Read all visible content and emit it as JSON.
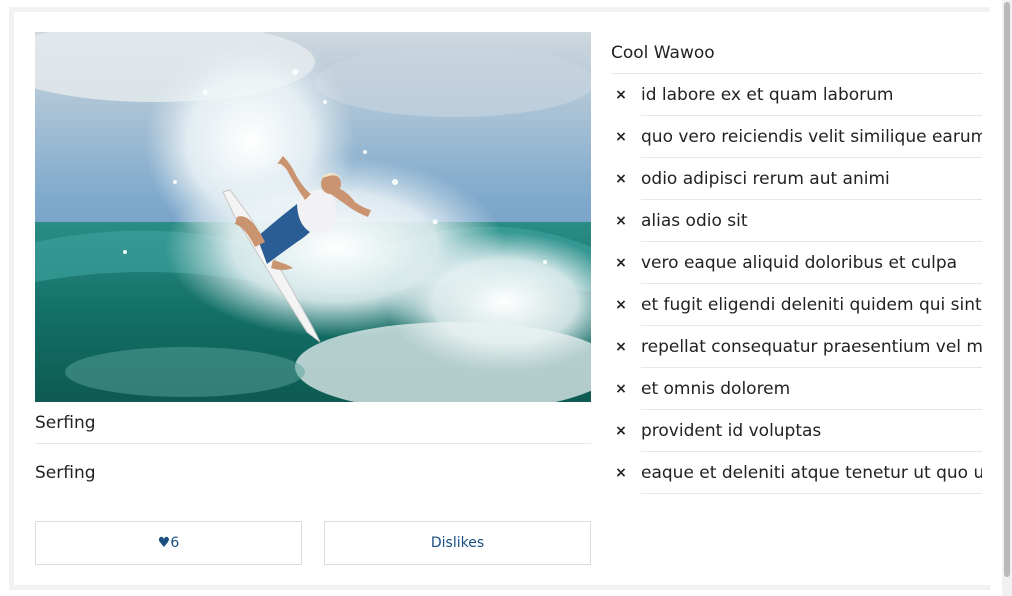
{
  "photo": {
    "alt": "surfer riding a wave"
  },
  "captions": [
    "Serfing",
    "Serfing"
  ],
  "buttons": {
    "like_label": "♥6",
    "dislike_label": "Dislikes"
  },
  "list": {
    "title": "Cool Wawoo",
    "remove_glyph": "×",
    "items": [
      "id labore ex et quam laborum",
      "quo vero reiciendis velit similique earum",
      "odio adipisci rerum aut animi",
      "alias odio sit",
      "vero eaque aliquid doloribus et culpa",
      "et fugit eligendi deleniti quidem qui sint nihil",
      "repellat consequatur praesentium vel minus",
      "et omnis dolorem",
      "provident id voluptas",
      "eaque et deleniti atque tenetur ut quo ut"
    ]
  },
  "colors": {
    "accent": "#1a4f80",
    "divider": "#e7e7e7"
  }
}
